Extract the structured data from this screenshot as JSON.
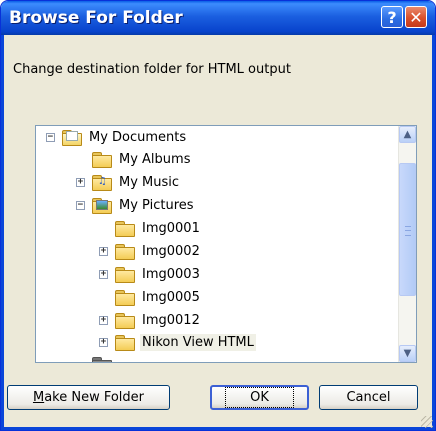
{
  "window": {
    "title": "Browse For Folder",
    "help_label": "?",
    "close_label": "✕"
  },
  "description": "Change destination folder for HTML output",
  "tree": {
    "items": [
      {
        "label": "My Documents",
        "expander": "−",
        "icon": "documents-folder-icon"
      },
      {
        "label": "My Albums",
        "expander": "",
        "icon": "folder-icon"
      },
      {
        "label": "My Music",
        "expander": "+",
        "icon": "music-folder-icon"
      },
      {
        "label": "My Pictures",
        "expander": "−",
        "icon": "pictures-folder-icon"
      },
      {
        "label": "Img0001",
        "expander": "",
        "icon": "folder-icon"
      },
      {
        "label": "Img0002",
        "expander": "+",
        "icon": "folder-icon"
      },
      {
        "label": "Img0003",
        "expander": "+",
        "icon": "folder-icon"
      },
      {
        "label": "Img0005",
        "expander": "",
        "icon": "folder-icon"
      },
      {
        "label": "Img0012",
        "expander": "+",
        "icon": "folder-icon"
      },
      {
        "label": "Nikon View HTML",
        "expander": "+",
        "icon": "folder-icon",
        "selected": true
      }
    ],
    "scroll_up_label": "▲",
    "scroll_down_label": "▼"
  },
  "buttons": {
    "make_new_folder_prefix": "M",
    "make_new_folder_rest": "ake New Folder",
    "ok": "OK",
    "cancel": "Cancel"
  },
  "colors": {
    "title_bar": "#0a5ee6",
    "dialog_bg": "#ece9d8",
    "selection_bg": "#f0f0e6",
    "close_button": "#d9502b"
  }
}
